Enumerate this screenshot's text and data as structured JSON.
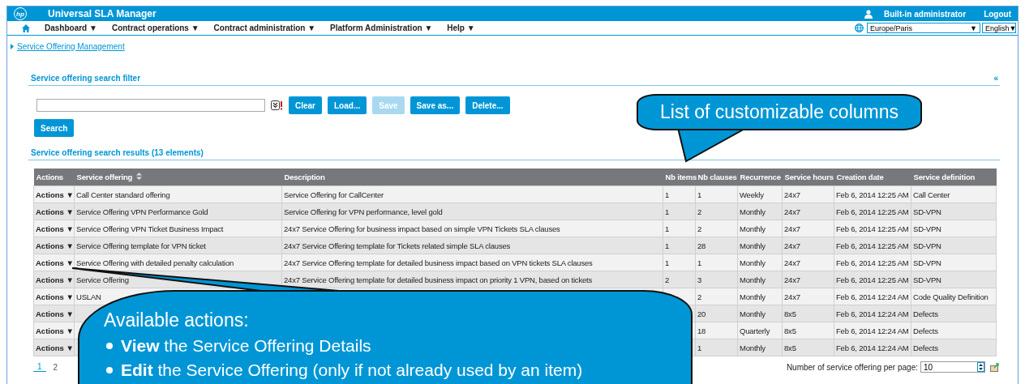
{
  "header": {
    "logo": "hp",
    "title": "Universal SLA Manager",
    "user": "Built-in administrator",
    "logout": "Logout"
  },
  "nav": {
    "menus": [
      {
        "label": "Dashboard ▼"
      },
      {
        "label": "Contract operations ▼"
      },
      {
        "label": "Contract administration ▼"
      },
      {
        "label": "Platform Administration ▼"
      },
      {
        "label": "Help ▼"
      }
    ],
    "timezone": "Europe/Paris",
    "language": "English",
    "dropdown_arrow": "▼"
  },
  "breadcrumb": "Service Offering Management",
  "filter": {
    "title": "Service offering search filter",
    "collapse": "«",
    "buttons": [
      {
        "label": "Clear",
        "disabled": false
      },
      {
        "label": "Load...",
        "disabled": false
      },
      {
        "label": "Save",
        "disabled": true
      },
      {
        "label": "Save as...",
        "disabled": false
      },
      {
        "label": "Delete...",
        "disabled": false
      }
    ],
    "search": "Search"
  },
  "results": {
    "title": "Service offering search results (13 elements)",
    "columns": [
      {
        "label": "Actions",
        "sorted": false
      },
      {
        "label": "Service offering",
        "sorted": true
      },
      {
        "label": "Description",
        "sorted": false
      },
      {
        "label": "Nb items",
        "sorted": false
      },
      {
        "label": "Nb clauses",
        "sorted": false
      },
      {
        "label": "Recurrence",
        "sorted": false
      },
      {
        "label": "Service hours",
        "sorted": false
      },
      {
        "label": "Creation date",
        "sorted": false
      },
      {
        "label": "Service definition",
        "sorted": false
      }
    ],
    "rows": [
      [
        "Actions ▼",
        "Call Center standard offering",
        "Service Offering for CallCenter",
        "1",
        "1",
        "Weekly",
        "24x7",
        "Feb 6, 2014 12:25 AM",
        "Call Center"
      ],
      [
        "Actions ▼",
        "Service Offering VPN Performance Gold",
        "Service Offering for VPN performance, level gold",
        "1",
        "2",
        "Monthly",
        "24x7",
        "Feb 6, 2014 12:25 AM",
        "SD-VPN"
      ],
      [
        "Actions ▼",
        "Service Offering VPN Ticket Business Impact",
        "24x7 Service Offering for business impact based on simple VPN Tickets SLA clauses",
        "1",
        "2",
        "Monthly",
        "24x7",
        "Feb 6, 2014 12:25 AM",
        "SD-VPN"
      ],
      [
        "Actions ▼",
        "Service Offering template for VPN ticket",
        "24x7 Service Offering template for Tickets related simple SLA clauses",
        "1",
        "28",
        "Monthly",
        "24x7",
        "Feb 6, 2014 12:25 AM",
        "SD-VPN"
      ],
      [
        "Actions ▼",
        "Service Offering with detailed penalty calculation",
        "24x7 Service Offering template for detailed business impact based on VPN tickets SLA clauses",
        "1",
        "1",
        "Monthly",
        "24x7",
        "Feb 6, 2014 12:25 AM",
        "SD-VPN"
      ],
      [
        "Actions ▼",
        "Service Offering",
        "24x7 Service Offering template for detailed business impact on priority 1 VPN, based on tickets",
        "2",
        "3",
        "Monthly",
        "24x7",
        "Feb 6, 2014 12:25 AM",
        "SD-VPN"
      ],
      [
        "Actions ▼",
        "USLAN",
        "",
        "",
        "2",
        "Monthly",
        "24x7",
        "Feb 6, 2014 12:24 AM",
        "Code Quality Definition"
      ],
      [
        "Actions ▼",
        "",
        "",
        "",
        "20",
        "Monthly",
        "8x5",
        "Feb 6, 2014 12:24 AM",
        "Defects"
      ],
      [
        "Actions ▼",
        "",
        "",
        "",
        "18",
        "Quarterly",
        "8x5",
        "Feb 6, 2014 12:24 AM",
        "Defects"
      ],
      [
        "Actions ▼",
        "",
        "",
        "",
        "1",
        "Monthly",
        "8x5",
        "Feb 6, 2014 12:24 AM",
        "Defects"
      ]
    ]
  },
  "pagination": {
    "pages": [
      {
        "label": "1",
        "selected": true
      },
      {
        "label": "2",
        "selected": false
      }
    ],
    "per_page_label": "Number of service offering per page:",
    "per_page": "10"
  },
  "callouts": [
    {
      "kind": "columns",
      "text": "List of customizable columns"
    },
    {
      "kind": "actions",
      "title": "Available actions:",
      "bullets": [
        "**View** the Service Offering Details",
        "**Edit**  the Service Offering (only if not already used  by an item)"
      ]
    }
  ]
}
